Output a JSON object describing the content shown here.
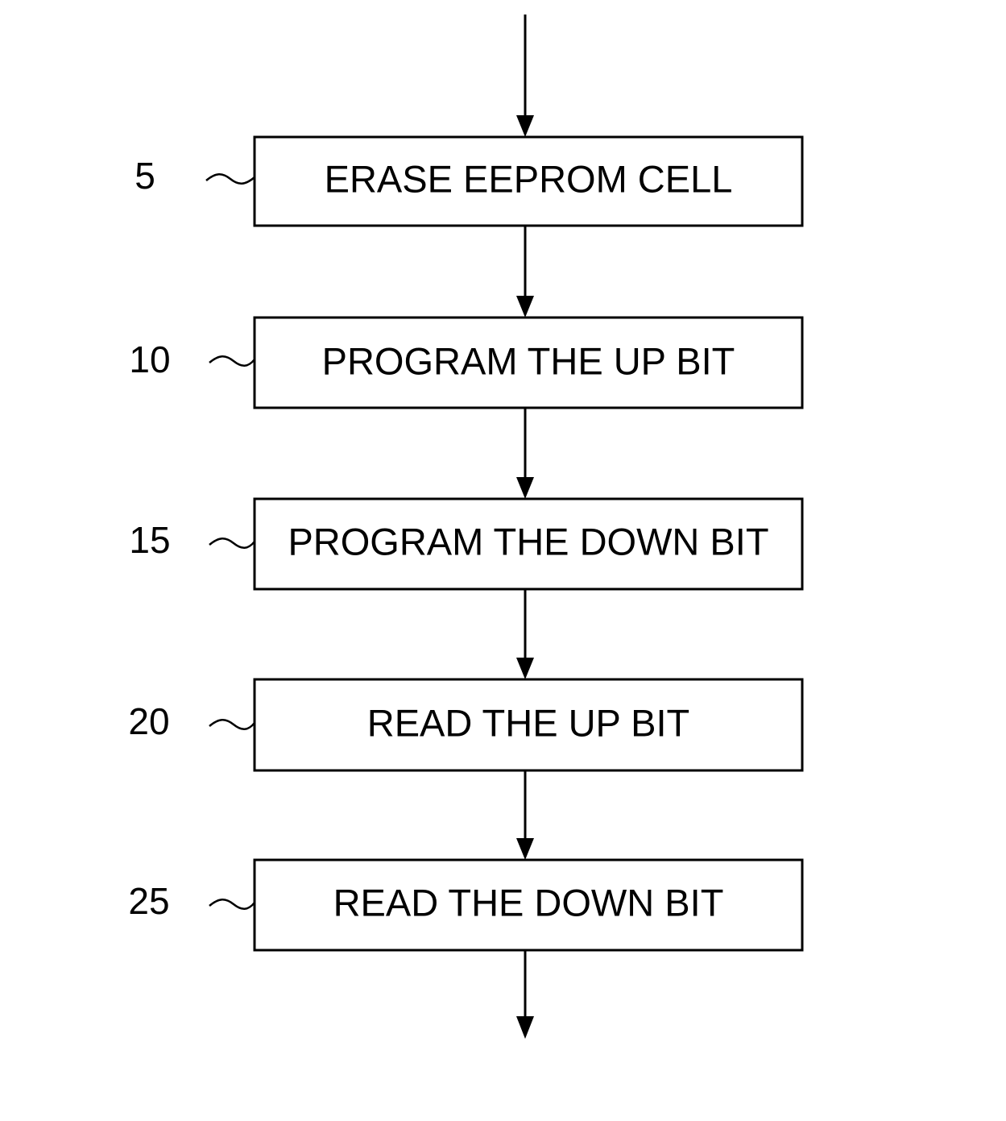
{
  "diagram": {
    "type": "flowchart",
    "direction": "top-to-bottom",
    "entry_arrow": true,
    "exit_arrow": true,
    "steps": [
      {
        "ref": "5",
        "label": "ERASE EEPROM CELL"
      },
      {
        "ref": "10",
        "label": "PROGRAM THE UP BIT"
      },
      {
        "ref": "15",
        "label": "PROGRAM THE DOWN BIT"
      },
      {
        "ref": "20",
        "label": "READ THE UP BIT"
      },
      {
        "ref": "25",
        "label": "READ THE DOWN BIT"
      }
    ],
    "edges": [
      {
        "from": "start",
        "to": "5"
      },
      {
        "from": "5",
        "to": "10"
      },
      {
        "from": "10",
        "to": "15"
      },
      {
        "from": "15",
        "to": "20"
      },
      {
        "from": "20",
        "to": "25"
      },
      {
        "from": "25",
        "to": "end"
      }
    ],
    "colors": {
      "line": "#000000",
      "background": "#ffffff"
    }
  }
}
